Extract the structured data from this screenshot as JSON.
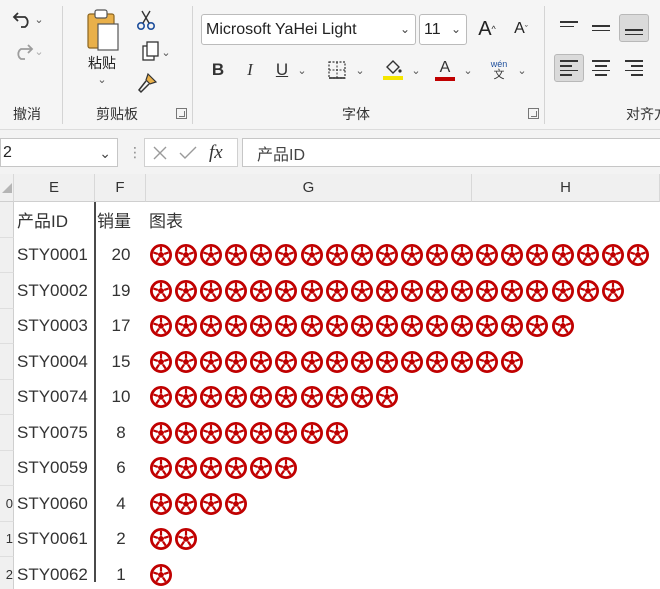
{
  "ribbon": {
    "undo_group_label": "撤消",
    "clipboard": {
      "paste_label": "粘贴",
      "group_label": "剪贴板"
    },
    "font": {
      "family": "Microsoft YaHei Light",
      "size": "11",
      "grow_label": "A",
      "shrink_label": "A",
      "bold": "B",
      "italic": "I",
      "underline": "U",
      "color_a": "A",
      "phonetic_top": "wén",
      "phonetic_bottom": "文",
      "group_label": "字体",
      "fill_color": "#f5e600",
      "font_color": "#c00000"
    },
    "alignment": {
      "group_label": "对齐方"
    }
  },
  "formula_bar": {
    "name_box": "2",
    "fx": "fx",
    "content": "产品ID"
  },
  "grid": {
    "col_headers": [
      "E",
      "F",
      "G",
      "H"
    ],
    "row_numbers": [
      "",
      "",
      "",
      "",
      "",
      "",
      "",
      "",
      "0",
      "1",
      "2"
    ],
    "header_row": {
      "id": "产品ID",
      "sales": "销量",
      "chart": "图表"
    },
    "rows": [
      {
        "id": "STY0001",
        "sales": 20
      },
      {
        "id": "STY0002",
        "sales": 19
      },
      {
        "id": "STY0003",
        "sales": 17
      },
      {
        "id": "STY0004",
        "sales": 15
      },
      {
        "id": "STY0074",
        "sales": 10
      },
      {
        "id": "STY0075",
        "sales": 8
      },
      {
        "id": "STY0059",
        "sales": 6
      },
      {
        "id": "STY0060",
        "sales": 4
      },
      {
        "id": "STY0061",
        "sales": 2
      },
      {
        "id": "STY0062",
        "sales": 1
      }
    ],
    "icon": "soccer-ball-icon",
    "icon_color": "#c00000"
  }
}
